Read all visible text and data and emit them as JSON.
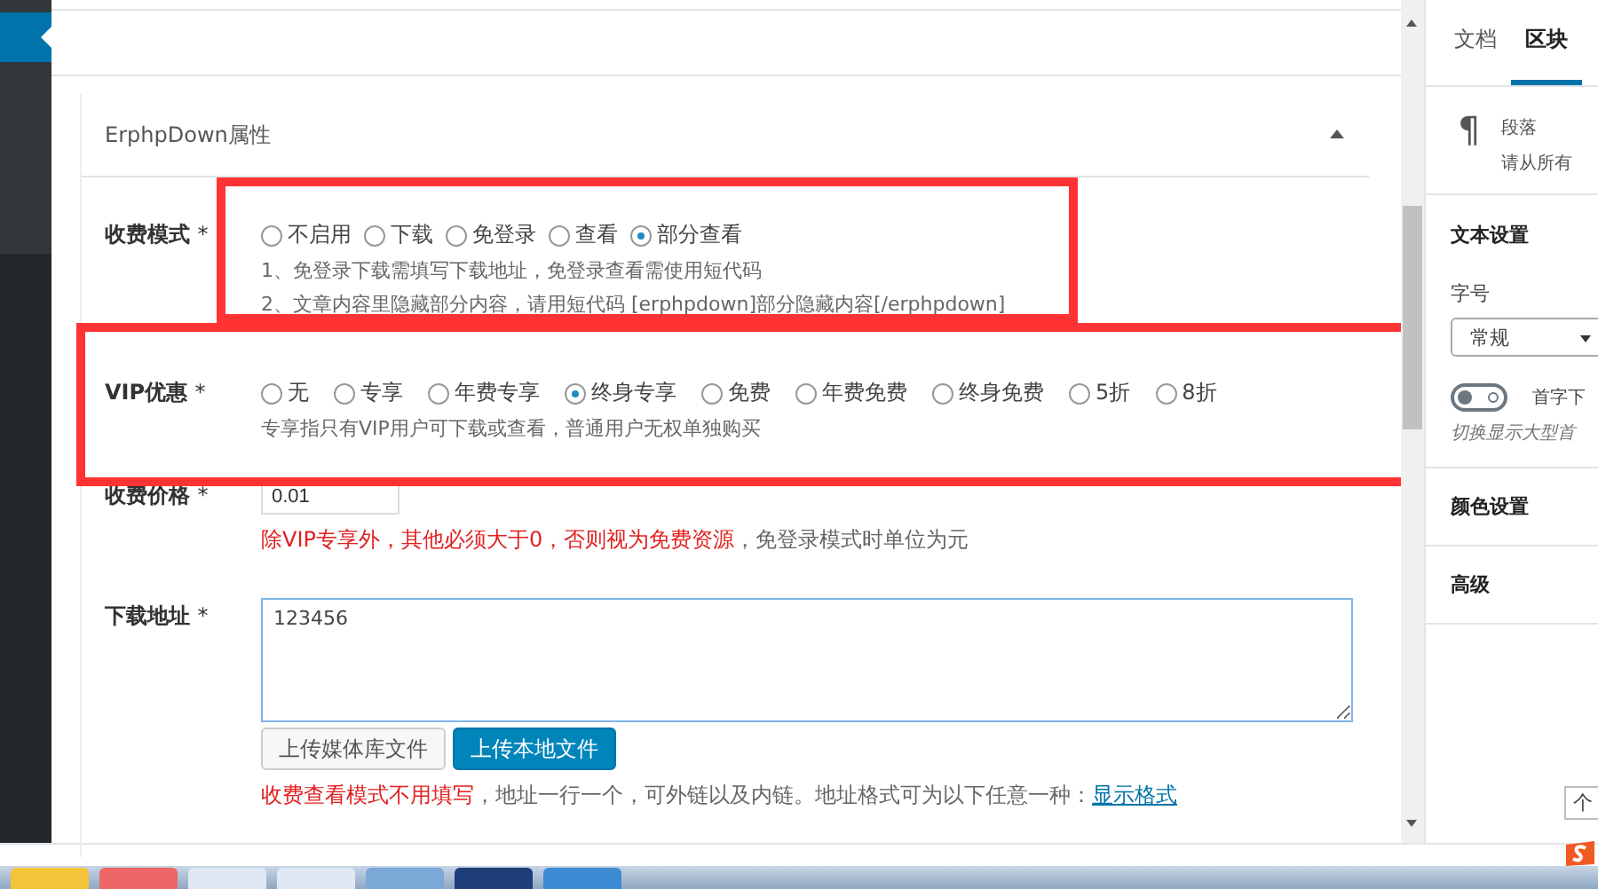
{
  "panel": {
    "title": "ErphpDown属性"
  },
  "fee_mode": {
    "label": "收费模式",
    "required": "*",
    "options": [
      {
        "label": "不启用",
        "selected": false
      },
      {
        "label": "下载",
        "selected": false
      },
      {
        "label": "免登录",
        "selected": false
      },
      {
        "label": "查看",
        "selected": false
      },
      {
        "label": "部分查看",
        "selected": true
      }
    ],
    "notes": [
      "1、免登录下载需填写下载地址，免登录查看需使用短代码",
      "2、文章内容里隐藏部分内容，请用短代码 [erphpdown]部分隐藏内容[/erphpdown]"
    ]
  },
  "vip": {
    "label": "VIP优惠",
    "required": "*",
    "options": [
      {
        "label": "无",
        "selected": false
      },
      {
        "label": "专享",
        "selected": false
      },
      {
        "label": "年费专享",
        "selected": false
      },
      {
        "label": "终身专享",
        "selected": true
      },
      {
        "label": "免费",
        "selected": false
      },
      {
        "label": "年费免费",
        "selected": false
      },
      {
        "label": "终身免费",
        "selected": false
      },
      {
        "label": "5折",
        "selected": false
      },
      {
        "label": "8折",
        "selected": false
      }
    ],
    "note": "专享指只有VIP用户可下载或查看，普通用户无权单独购买"
  },
  "price": {
    "label": "收费价格",
    "required": "*",
    "value": "0.01",
    "note_warning": "除VIP专享外，其他必须大于0，否则视为免费资源",
    "note_rest": "，免登录模式时单位为元"
  },
  "download": {
    "label": "下载地址",
    "required": "*",
    "value": "123456",
    "buttons": [
      {
        "label": "上传媒体库文件",
        "kind": "secondary"
      },
      {
        "label": "上传本地文件",
        "kind": "primary"
      }
    ],
    "note_warning": "收费查看模式不用填写",
    "note_rest": "，地址一行一个，可外链以及内链。地址格式可为以下任意一种：",
    "link": "显示格式"
  },
  "sidebar": {
    "tabs": [
      {
        "label": "文档",
        "selected": false
      },
      {
        "label": "区块",
        "selected": true
      }
    ],
    "block": {
      "icon": "¶",
      "name": "段落",
      "desc": "请从所有"
    },
    "text_settings": {
      "title": "文本设置",
      "size_label": "字号",
      "size_value": "常规",
      "dropcap_label": "首字下",
      "dropcap_on": false,
      "dropcap_help": "切换显示大型首"
    },
    "sections": [
      "颜色设置",
      "高级"
    ]
  },
  "ime_hint": "个"
}
